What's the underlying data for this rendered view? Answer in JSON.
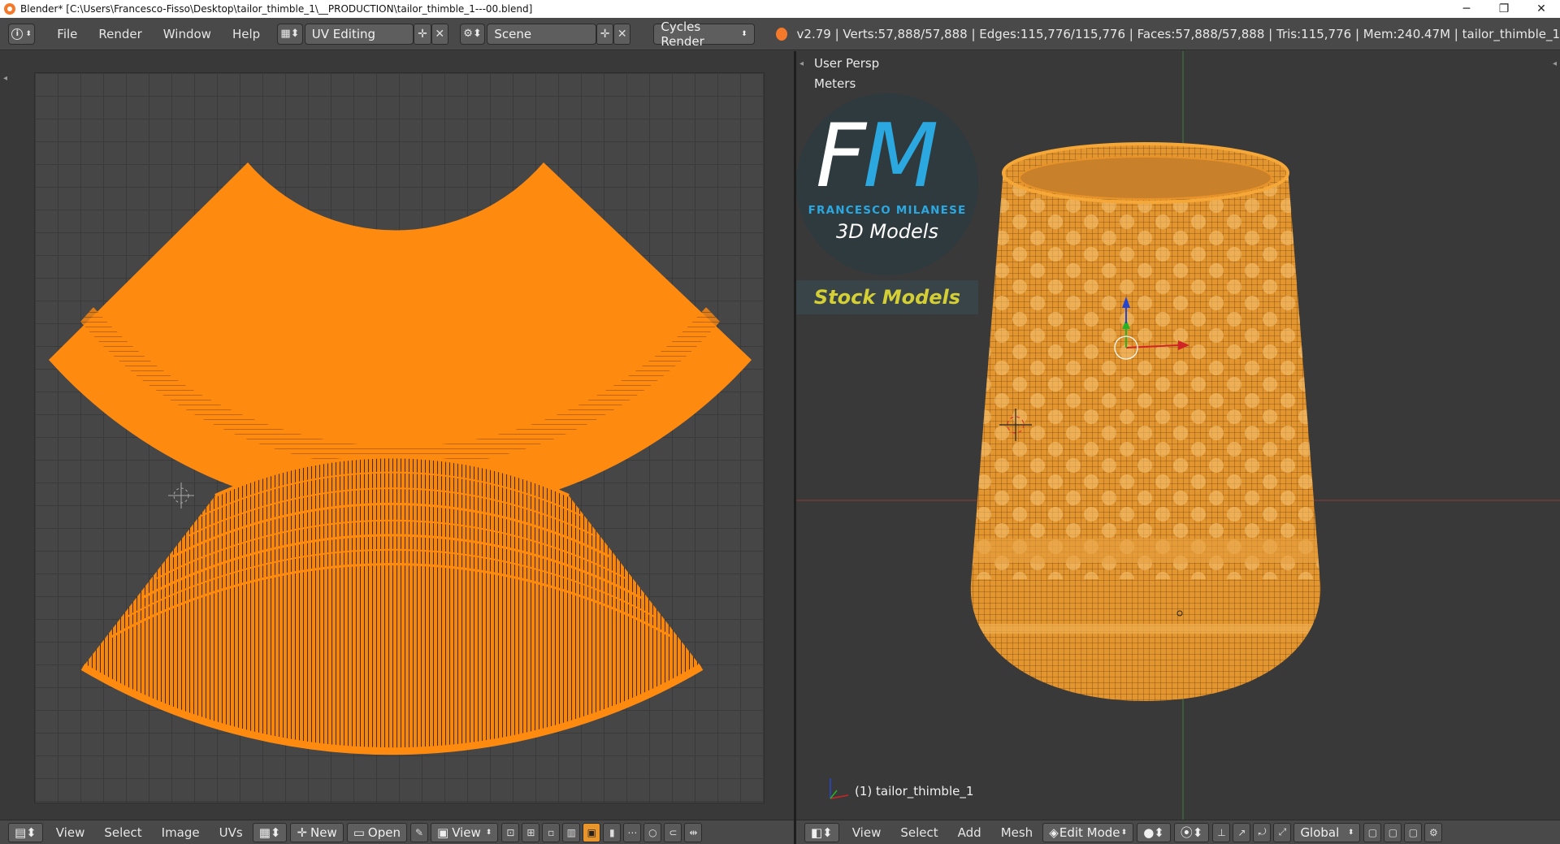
{
  "window": {
    "title": "Blender* [C:\\Users\\Francesco-Fisso\\Desktop\\tailor_thimble_1\\__PRODUCTION\\tailor_thimble_1---00.blend]",
    "minimize": "─",
    "restore": "❐",
    "close": "✕"
  },
  "topbar": {
    "info_icon": "i",
    "menus": [
      "File",
      "Render",
      "Window",
      "Help"
    ],
    "layout_name": "UV Editing",
    "scene_name": "Scene",
    "render_engine": "Cycles Render",
    "stats": "v2.79 | Verts:57,888/57,888 | Edges:115,776/115,776 | Faces:57,888/57,888 | Tris:115,776 | Mem:240.47M | tailor_thimble_1"
  },
  "uv_editor": {
    "menus": [
      "View",
      "Select",
      "Image",
      "UVs"
    ],
    "new_label": "New",
    "open_label": "Open",
    "view_label": "View"
  },
  "viewport": {
    "persp_label": "User Persp",
    "units_label": "Meters",
    "object_label": "(1) tailor_thimble_1",
    "menus": [
      "View",
      "Select",
      "Add",
      "Mesh"
    ],
    "mode": "Edit Mode",
    "orientation": "Global"
  },
  "logo": {
    "f": "F",
    "m": "M",
    "name": "FRANCESCO MILANESE",
    "sub": "3D Models",
    "stock": "Stock Models"
  },
  "colors": {
    "uv_orange": "#ff8a10",
    "mesh_orange": "#f0a030",
    "logo_blue": "#2ba8e0",
    "stock_yellow": "#d3cf34"
  }
}
